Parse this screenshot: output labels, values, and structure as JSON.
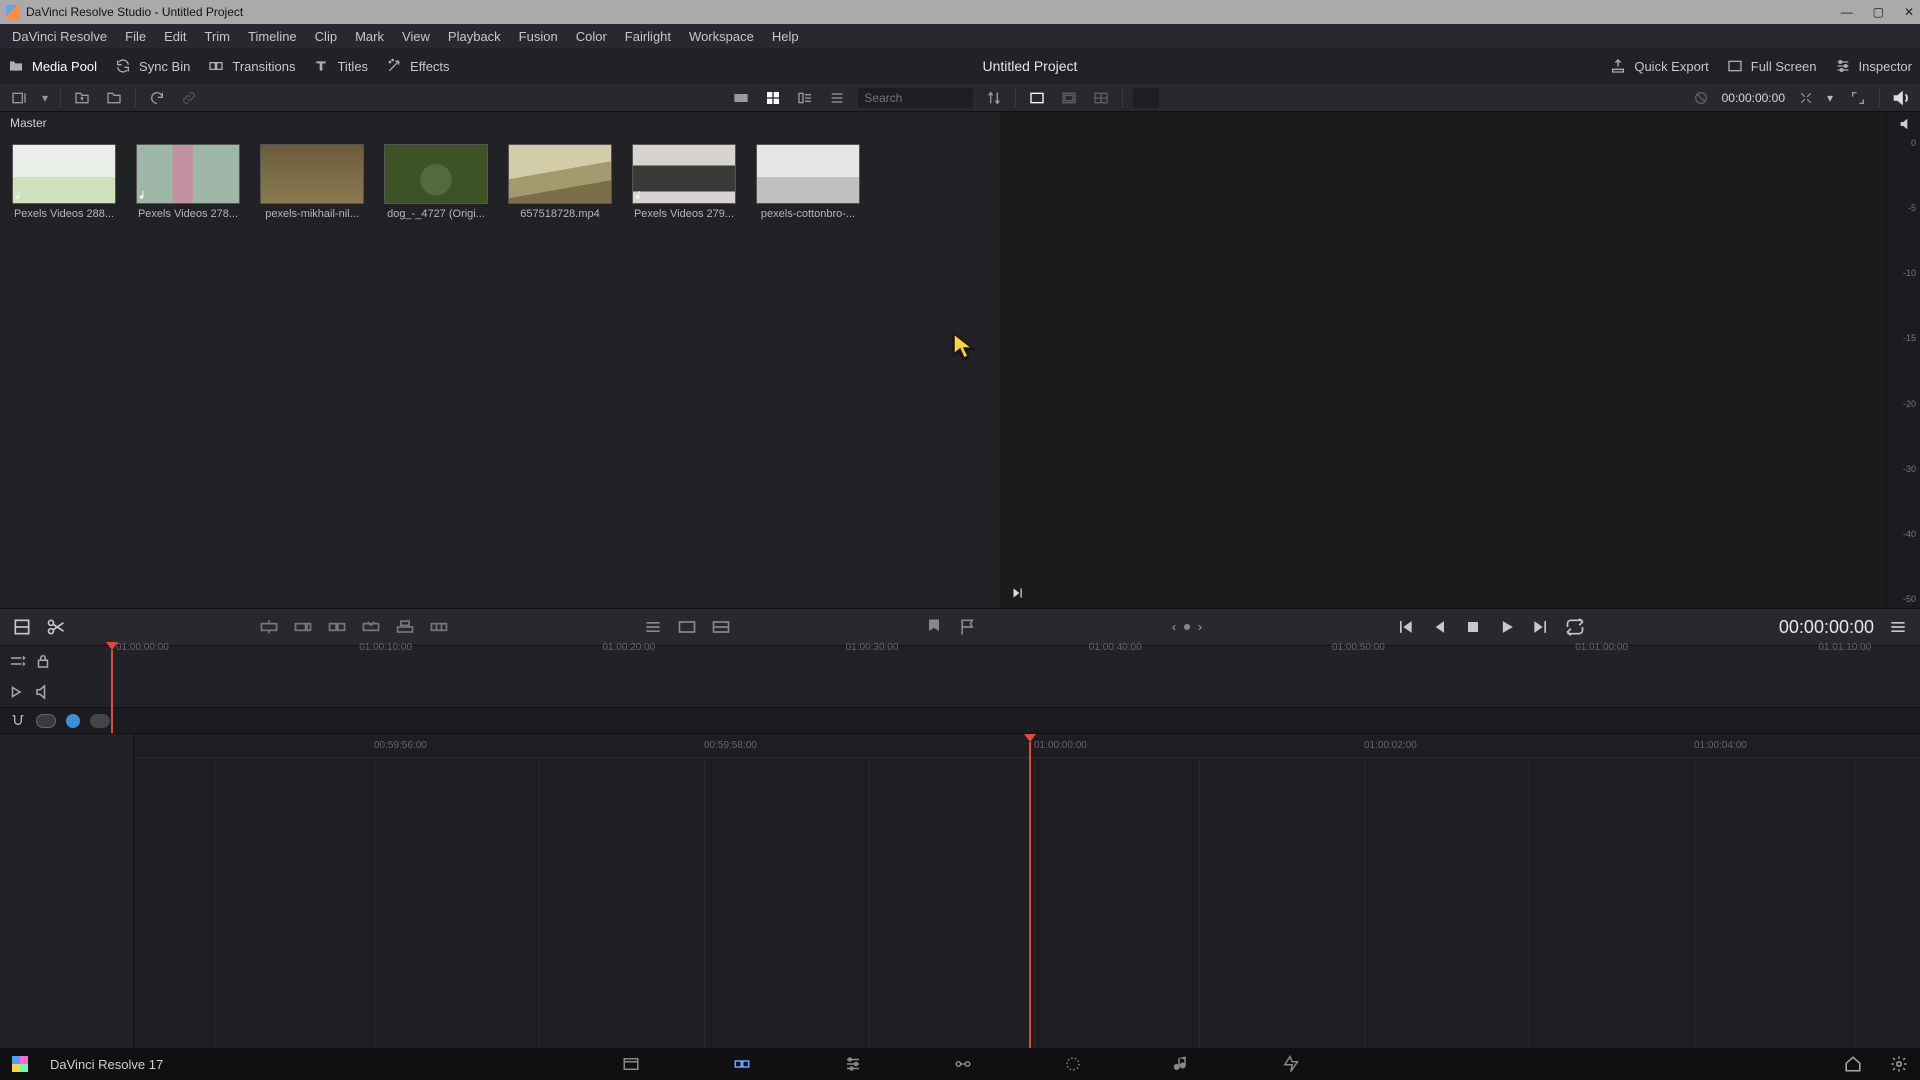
{
  "window": {
    "title": "DaVinci Resolve Studio - Untitled Project"
  },
  "menu": [
    "DaVinci Resolve",
    "File",
    "Edit",
    "Trim",
    "Timeline",
    "Clip",
    "Mark",
    "View",
    "Playback",
    "Fusion",
    "Color",
    "Fairlight",
    "Workspace",
    "Help"
  ],
  "top_tabs": {
    "left": [
      {
        "id": "media-pool",
        "label": "Media Pool",
        "active": true
      },
      {
        "id": "sync-bin",
        "label": "Sync Bin",
        "active": false
      },
      {
        "id": "transitions",
        "label": "Transitions",
        "active": false
      },
      {
        "id": "titles",
        "label": "Titles",
        "active": false
      },
      {
        "id": "effects",
        "label": "Effects",
        "active": false
      }
    ],
    "center": "Untitled Project",
    "right": [
      {
        "id": "quick-export",
        "label": "Quick Export"
      },
      {
        "id": "full-screen",
        "label": "Full Screen"
      },
      {
        "id": "inspector",
        "label": "Inspector"
      }
    ]
  },
  "toolbar": {
    "search_placeholder": "Search",
    "timecode": "00:00:00:00"
  },
  "breadcrumb": "Master",
  "clips": [
    {
      "name": "Pexels Videos 288...",
      "audio": true,
      "thumb": "th1"
    },
    {
      "name": "Pexels Videos 278...",
      "audio": true,
      "thumb": "th2"
    },
    {
      "name": "pexels-mikhail-nil...",
      "audio": false,
      "thumb": "th3"
    },
    {
      "name": "dog_-_4727 (Origi...",
      "audio": false,
      "thumb": "th4"
    },
    {
      "name": "657518728.mp4",
      "audio": false,
      "thumb": "th5"
    },
    {
      "name": "Pexels Videos 279...",
      "audio": true,
      "thumb": "th6"
    },
    {
      "name": "pexels-cottonbro-...",
      "audio": false,
      "thumb": "th7"
    }
  ],
  "meter_ticks": [
    "0",
    "-5",
    "-10",
    "-15",
    "-20",
    "-30",
    "-40",
    "-50"
  ],
  "transport_tc": "00:00:00:00",
  "upper_ruler": [
    "01:00:00:00",
    "01:00:10:00",
    "01:00:20:00",
    "01:00:30:00",
    "01:00:40:00",
    "01:00:50:00",
    "01:01:00:00",
    "01:01:10:00"
  ],
  "lower_ruler": [
    "00:59:56:00",
    "00:59:58:00",
    "01:00:00:00",
    "01:00:02:00",
    "01:00:04:00"
  ],
  "bottom": {
    "app": "DaVinci Resolve 17"
  }
}
